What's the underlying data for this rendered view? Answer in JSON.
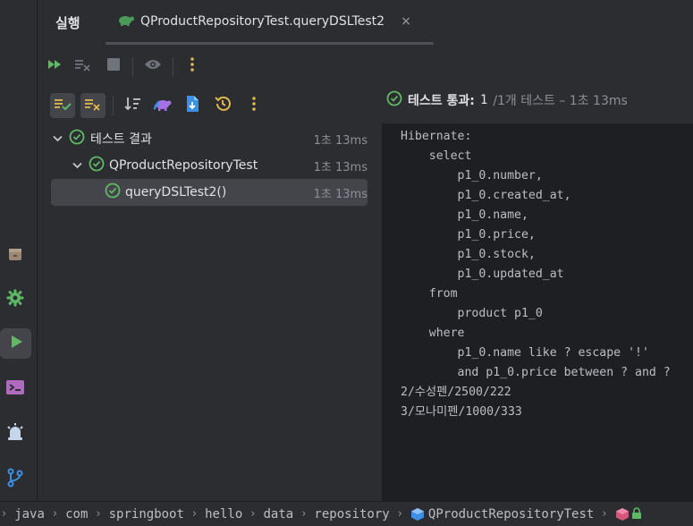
{
  "header": {
    "run_title": "실행",
    "tab_label": "QProductRepositoryTest.queryDSLTest2",
    "tab_close": "×"
  },
  "status": {
    "main": "테스트 통과:",
    "count": "1",
    "rest": "/1개 테스트 – 1초 13ms"
  },
  "tree": {
    "rows": [
      {
        "label": "테스트 결과",
        "time": "1초 13ms"
      },
      {
        "label": "QProductRepositoryTest",
        "time": "1초 13ms"
      },
      {
        "label": "queryDSLTest2()",
        "time": "1초 13ms"
      }
    ]
  },
  "console": {
    "lines": [
      "Hibernate:",
      "    select",
      "        p1_0.number,",
      "        p1_0.created_at,",
      "        p1_0.name,",
      "        p1_0.price,",
      "        p1_0.stock,",
      "        p1_0.updated_at",
      "    from",
      "        product p1_0",
      "    where",
      "        p1_0.name like ? escape '!'",
      "        and p1_0.price between ? and ?",
      "2/수성펜/2500/222",
      "3/모나미펜/1000/333"
    ]
  },
  "breadcrumb": {
    "items": [
      "java",
      "com",
      "springboot",
      "hello",
      "data",
      "repository",
      "QProductRepositoryTest"
    ],
    "sep": "›"
  },
  "colors": {
    "success": "#5fb865",
    "accent_play": "#5fb865",
    "warning": "#e0b94a",
    "blue": "#3d8fe6",
    "purple": "#a571e6"
  }
}
